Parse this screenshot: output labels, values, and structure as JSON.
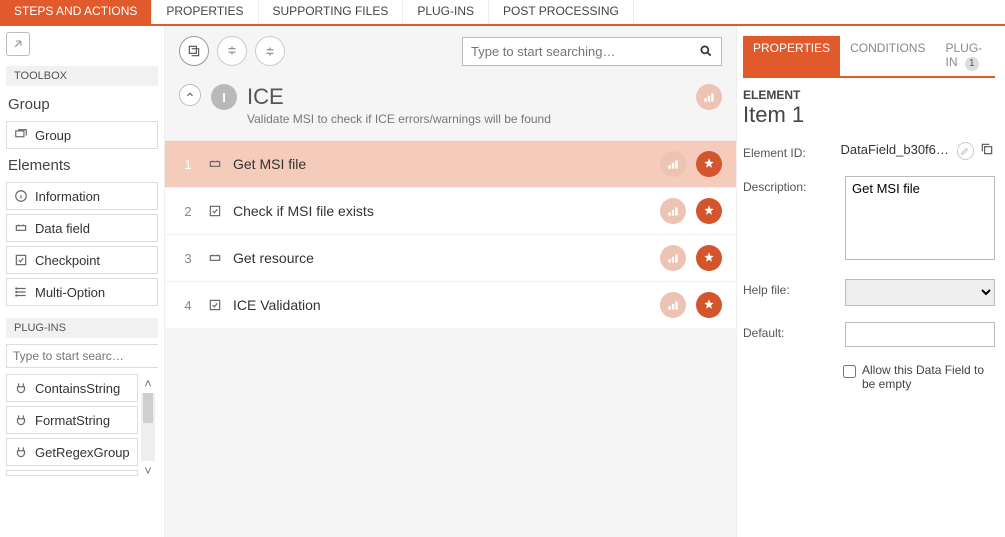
{
  "top_tabs": {
    "steps": "STEPS AND ACTIONS",
    "properties": "PROPERTIES",
    "supporting": "SUPPORTING FILES",
    "plugins": "PLUG-INS",
    "post": "POST PROCESSING"
  },
  "toolbox": {
    "header": "TOOLBOX",
    "group_title": "Group",
    "group_item": "Group",
    "elements_title": "Elements",
    "elements": {
      "info": "Information",
      "datafield": "Data field",
      "checkpoint": "Checkpoint",
      "multioption": "Multi-Option"
    },
    "plugins_header": "PLUG-INS",
    "plugin_search_placeholder": "Type to start searc…",
    "plugins": {
      "contains": "ContainsString",
      "format": "FormatString",
      "regex": "GetRegexGroup"
    }
  },
  "center": {
    "search_placeholder": "Type to start searching…",
    "group_badge": "I",
    "group_title": "ICE",
    "group_sub": "Validate MSI to check if ICE errors/warnings will be found",
    "steps": [
      {
        "num": "1",
        "label": "Get MSI file",
        "type": "datafield",
        "selected": true
      },
      {
        "num": "2",
        "label": "Check if MSI file exists",
        "type": "checkpoint",
        "selected": false
      },
      {
        "num": "3",
        "label": "Get resource",
        "type": "datafield",
        "selected": false
      },
      {
        "num": "4",
        "label": "ICE Validation",
        "type": "checkpoint",
        "selected": false
      }
    ]
  },
  "right": {
    "tabs": {
      "properties": "PROPERTIES",
      "conditions": "CONDITIONS",
      "plugin": "PLUG-IN",
      "plugin_count": "1"
    },
    "heading": "ELEMENT",
    "title": "Item  1",
    "labels": {
      "element_id": "Element ID:",
      "description": "Description:",
      "help_file": "Help file:",
      "default": "Default:"
    },
    "element_id_value": "DataField_b30f6b…",
    "description_value": "Get MSI file",
    "allow_empty": "Allow this Data Field to be empty"
  }
}
